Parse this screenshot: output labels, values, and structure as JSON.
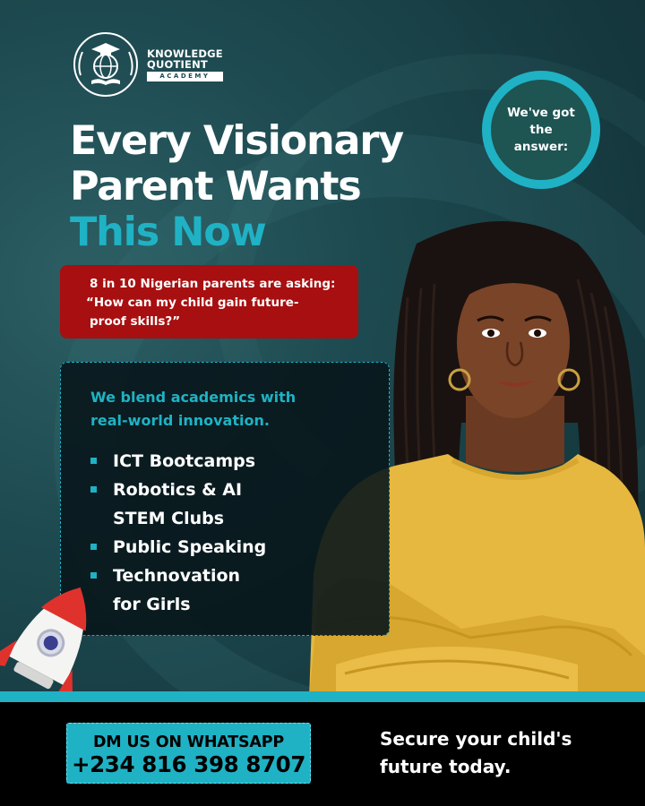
{
  "brand": {
    "line1": "KNOWLEDGE",
    "line2": "QUOTIENT",
    "line3": "ACADEMY"
  },
  "answer_badge": {
    "text": "We've got the answer:"
  },
  "headline": {
    "line1": "Every Visionary",
    "line2": "Parent Wants",
    "line3": "This Now"
  },
  "stat_box": {
    "line1": "8 in 10 Nigerian parents are asking:",
    "line2": "“How can my child gain future-",
    "line3": "proof skills?”"
  },
  "programs": {
    "intro_line1": "We blend academics with",
    "intro_line2": "real-world innovation.",
    "items": [
      {
        "line1": "ICT Bootcamps",
        "line2": ""
      },
      {
        "line1": "Robotics & AI",
        "line2": "STEM Clubs"
      },
      {
        "line1": "Public Speaking",
        "line2": ""
      },
      {
        "line1": "Technovation",
        "line2": "for Girls"
      }
    ]
  },
  "cta": {
    "line1": "DM US ON WHATSAPP",
    "phone": "+234 816 398 8707"
  },
  "tagline": {
    "line1": "Secure your child's",
    "line2": "future today."
  },
  "colors": {
    "background": "#1d4a50",
    "accent_teal": "#1fb2c4",
    "alert_red": "#a80f10",
    "footer": "#000000",
    "sweater_yellow": "#e6b840"
  }
}
